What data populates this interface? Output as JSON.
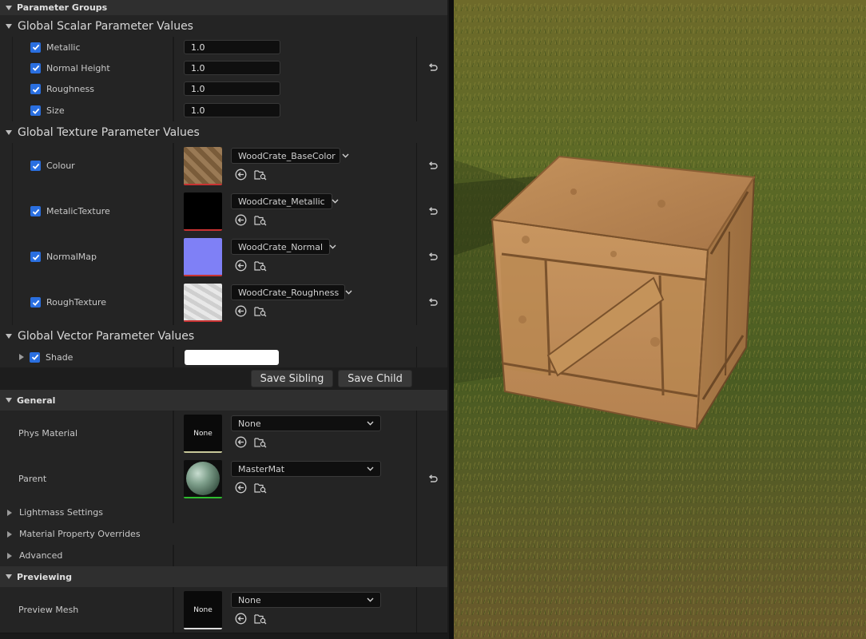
{
  "details": {
    "parameter_groups_label": "Parameter Groups",
    "scalar_group": {
      "title": "Global Scalar Parameter Values",
      "params": [
        {
          "name": "Metallic",
          "value": "1.0"
        },
        {
          "name": "Normal Height",
          "value": "1.0"
        },
        {
          "name": "Roughness",
          "value": "1.0"
        },
        {
          "name": "Size",
          "value": "1.0"
        }
      ]
    },
    "texture_group": {
      "title": "Global Texture Parameter Values",
      "params": [
        {
          "name": "Colour",
          "asset": "WoodCrate_BaseColor"
        },
        {
          "name": "MetalicTexture",
          "asset": "WoodCrate_Metallic"
        },
        {
          "name": "NormalMap",
          "asset": "WoodCrate_Normal"
        },
        {
          "name": "RoughTexture",
          "asset": "WoodCrate_Roughness"
        }
      ]
    },
    "vector_group": {
      "title": "Global Vector Parameter Values",
      "params": [
        {
          "name": "Shade",
          "color": "#ffffff"
        }
      ]
    },
    "buttons": {
      "save_sibling": "Save Sibling",
      "save_child": "Save Child"
    },
    "general": {
      "title": "General",
      "phys_material": {
        "label": "Phys Material",
        "thumb": "None",
        "value": "None"
      },
      "parent": {
        "label": "Parent",
        "value": "MasterMat"
      }
    },
    "collapsed_sections": [
      "Lightmass Settings",
      "Material Property Overrides",
      "Advanced"
    ],
    "previewing": {
      "title": "Previewing",
      "preview_mesh": {
        "label": "Preview Mesh",
        "thumb": "None",
        "value": "None"
      }
    }
  },
  "colors": {
    "checkbox": "#2a6fe0",
    "texture_bar": "#c83232",
    "material_bar": "#2ebd2e",
    "physmat_bar": "#c8c89a"
  },
  "icons": {
    "reset": "reset-arrow-icon",
    "use_selected": "use-selected-arrow-icon",
    "browse": "browse-folder-icon",
    "checkbox": "checkmark-icon",
    "dropdown": "chevron-down-icon"
  }
}
